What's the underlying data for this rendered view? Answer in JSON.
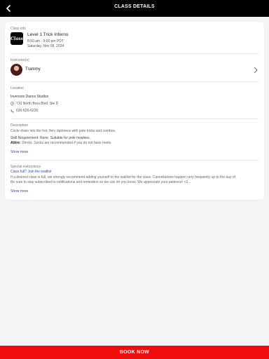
{
  "header": {
    "title": "CLASS DETAILS",
    "back_icon": "chevron-left-icon"
  },
  "class_info": {
    "label": "Class info",
    "logo_text": "Class",
    "name": "Level 1 Trick Inferno",
    "time": "8:00 am - 9:00 pm PDT",
    "date": "Saturday, Nov 09, 2024"
  },
  "instructor": {
    "label": "Instructor(s)",
    "name": "Trammy"
  },
  "location": {
    "label": "Location",
    "studio": "Inversion Dance Studios",
    "address": "710 North Brea Blvd. Ste D",
    "phone": "626-626-6226"
  },
  "description": {
    "label": "Description",
    "text": "Circle down into the hot, fiery darkness with pole tricks and combos.",
    "skill_label": "Skill Requirement:",
    "skill_value": "None. Suitable for pole newbies.",
    "attire_label": "Attire:",
    "attire_value": "Shorts. Socks are recommended if you do not have heels.",
    "show_more": "Show more"
  },
  "special_instructions": {
    "label": "Special instructions",
    "link": "Class full? Join the waitlist",
    "line1": "If a desired class is full, we strongly recommend adding yourself to the waitlist for the class.  Cancellations happen very frequently up to the day of.",
    "line2": "Be sure to stay subscribed to notifications and reminders so we can let you know.  We appreciate your patience! <3...",
    "show_more": "Show more"
  },
  "footer": {
    "book_label": "BOOK NOW"
  },
  "colors": {
    "header_bg": "#000000",
    "book_bg": "#ee0d0d",
    "link": "#1f4fd6"
  }
}
